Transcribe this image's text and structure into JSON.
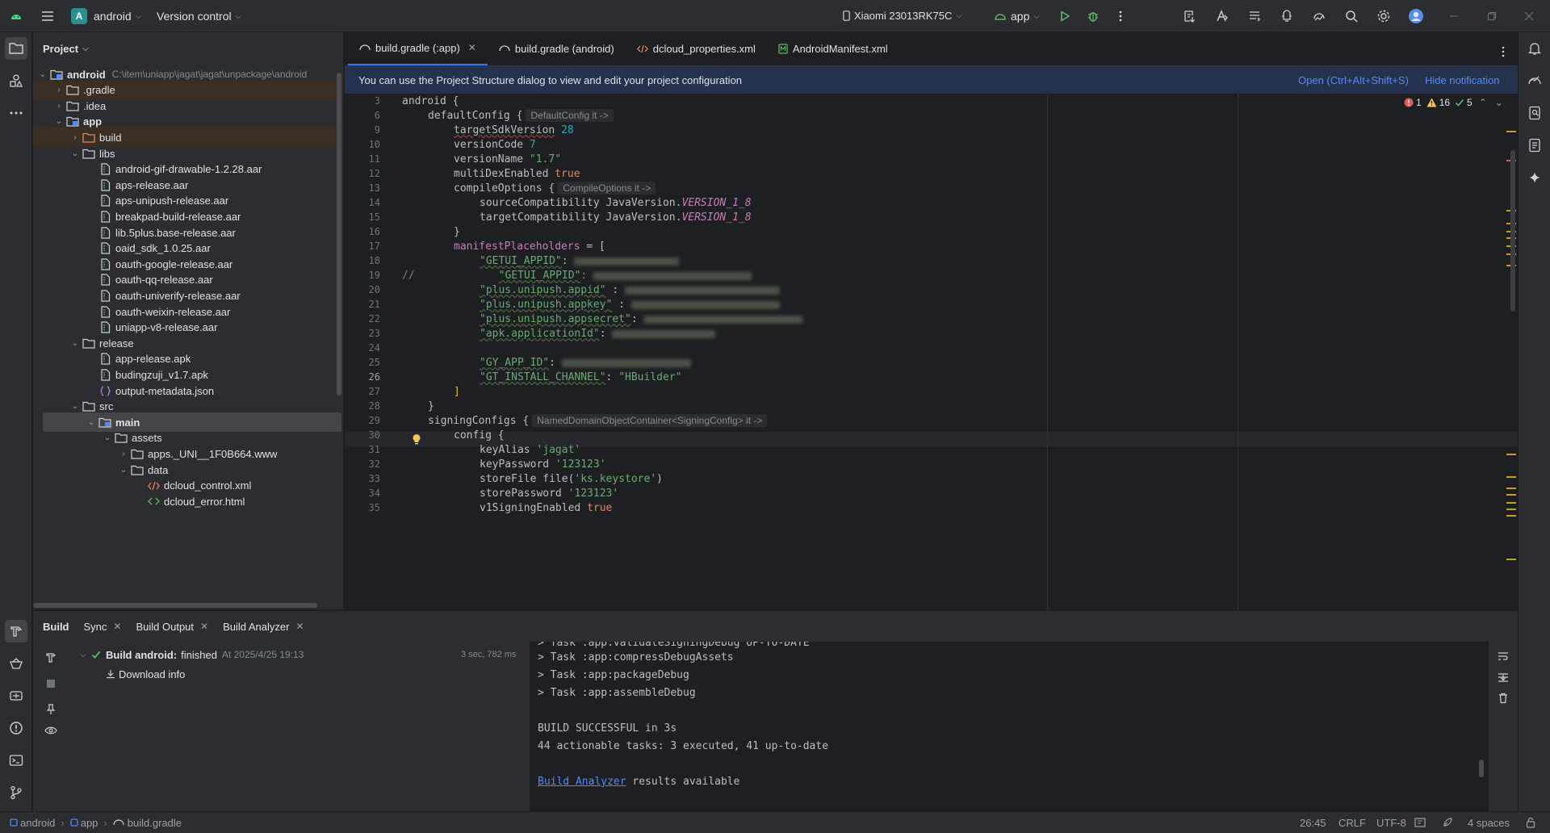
{
  "titlebar": {
    "project_initial": "A",
    "project_name": "android",
    "vcs": "Version control",
    "device": "Xiaomi 23013RK75C",
    "run_config": "app"
  },
  "project_panel": {
    "title": "Project",
    "tree": [
      {
        "label": "android",
        "hint": "C:\\item\\uniapp\\jagat\\jagat\\unpackage\\android",
        "depth": 0,
        "arrow": "open",
        "icon": "module-folder",
        "bold": true
      },
      {
        "label": ".gradle",
        "depth": 1,
        "arrow": "closed",
        "icon": "folder",
        "highlight": true
      },
      {
        "label": ".idea",
        "depth": 1,
        "arrow": "closed",
        "icon": "folder"
      },
      {
        "label": "app",
        "depth": 1,
        "arrow": "open",
        "icon": "module-folder",
        "bold": true
      },
      {
        "label": "build",
        "depth": 2,
        "arrow": "closed",
        "icon": "folder-orange",
        "highlight": true
      },
      {
        "label": "libs",
        "depth": 2,
        "arrow": "open",
        "icon": "folder"
      },
      {
        "label": "android-gif-drawable-1.2.28.aar",
        "depth": 3,
        "icon": "archive"
      },
      {
        "label": "aps-release.aar",
        "depth": 3,
        "icon": "archive"
      },
      {
        "label": "aps-unipush-release.aar",
        "depth": 3,
        "icon": "archive"
      },
      {
        "label": "breakpad-build-release.aar",
        "depth": 3,
        "icon": "archive"
      },
      {
        "label": "lib.5plus.base-release.aar",
        "depth": 3,
        "icon": "archive"
      },
      {
        "label": "oaid_sdk_1.0.25.aar",
        "depth": 3,
        "icon": "archive"
      },
      {
        "label": "oauth-google-release.aar",
        "depth": 3,
        "icon": "archive"
      },
      {
        "label": "oauth-qq-release.aar",
        "depth": 3,
        "icon": "archive"
      },
      {
        "label": "oauth-univerify-release.aar",
        "depth": 3,
        "icon": "archive"
      },
      {
        "label": "oauth-weixin-release.aar",
        "depth": 3,
        "icon": "archive"
      },
      {
        "label": "uniapp-v8-release.aar",
        "depth": 3,
        "icon": "archive"
      },
      {
        "label": "release",
        "depth": 2,
        "arrow": "open",
        "icon": "folder"
      },
      {
        "label": "app-release.apk",
        "depth": 3,
        "icon": "archive"
      },
      {
        "label": "budingzuji_v1.7.apk",
        "depth": 3,
        "icon": "archive"
      },
      {
        "label": "output-metadata.json",
        "depth": 3,
        "icon": "json"
      },
      {
        "label": "src",
        "depth": 2,
        "arrow": "open",
        "icon": "folder"
      },
      {
        "label": "main",
        "depth": 3,
        "arrow": "open",
        "icon": "module-folder",
        "bold": true,
        "selected": true
      },
      {
        "label": "assets",
        "depth": 4,
        "arrow": "open",
        "icon": "folder"
      },
      {
        "label": "apps._UNI__1F0B664.www",
        "depth": 5,
        "arrow": "closed",
        "icon": "folder"
      },
      {
        "label": "data",
        "depth": 5,
        "arrow": "open",
        "icon": "folder"
      },
      {
        "label": "dcloud_control.xml",
        "depth": 6,
        "icon": "xml"
      },
      {
        "label": "dcloud_error.html",
        "depth": 6,
        "icon": "html"
      }
    ]
  },
  "editor": {
    "tabs": [
      {
        "label": "build.gradle (:app)",
        "active": true,
        "closable": true
      },
      {
        "label": "build.gradle (android)"
      },
      {
        "label": "dcloud_properties.xml"
      },
      {
        "label": "AndroidManifest.xml"
      }
    ],
    "notification": {
      "text": "You can use the Project Structure dialog to view and edit your project configuration",
      "open_link": "Open (Ctrl+Alt+Shift+S)",
      "hide_link": "Hide notification"
    },
    "inspections": {
      "errors": "1",
      "warnings": "16",
      "ok": "5"
    },
    "line_numbers": [
      "3",
      "6",
      "9",
      "10",
      "11",
      "12",
      "13",
      "14",
      "15",
      "16",
      "17",
      "18",
      "19",
      "20",
      "21",
      "22",
      "23",
      "24",
      "25",
      "26",
      "27",
      "28",
      "29",
      "30",
      "31",
      "32",
      "33",
      "34",
      "35"
    ],
    "current_line": "26",
    "code": {
      "l3": "android {",
      "l6": "defaultConfig {",
      "l6_hint": "DefaultConfig it ->",
      "l9_key": "targetSdkVersion",
      "l9_val": "28",
      "l10_key": "versionCode",
      "l10_val": "7",
      "l11_key": "versionName",
      "l11_val": "\"1.7\"",
      "l12_key": "multiDexEnabled",
      "l12_val": "true",
      "l13": "compileOptions {",
      "l13_hint": "CompileOptions it ->",
      "l14_key": "sourceCompatibility JavaVersion.",
      "l14_val": "VERSION_1_8",
      "l15_key": "targetCompatibility JavaVersion.",
      "l15_val": "VERSION_1_8",
      "l16": "}",
      "l17_key": "manifestPlaceholders",
      "l17_rest": " = [",
      "l18_key": "\"GETUI_APPID\"",
      "l18_sep": ": ",
      "l19_comment": "//",
      "l19_key": "\"GETUI_APPID\"",
      "l19_sep": ": ",
      "l20_key": "\"plus.unipush.appid\"",
      "l20_sep": " : ",
      "l21_key": "\"plus.unipush.appkey\"",
      "l21_sep": " : ",
      "l22_key": "\"plus.unipush.appsecret\"",
      "l22_sep": ": ",
      "l23_key": "\"apk.applicationId\"",
      "l23_sep": ": ",
      "l25_key": "\"GY_APP_ID\"",
      "l25_sep": ": ",
      "l26_key": "\"GT_INSTALL_CHANNEL\"",
      "l26_sep": ": ",
      "l26_val": "\"HBuilder\"",
      "l27": "]",
      "l28": "}",
      "l29": "signingConfigs {",
      "l29_hint": "NamedDomainObjectContainer<SigningConfig> it ->",
      "l30": "config {",
      "l31_key": "keyAlias",
      "l31_val": "'jagat'",
      "l32_key": "keyPassword",
      "l32_val": "'123123'",
      "l33_key": "storeFile file(",
      "l33_val": "'ks.keystore'",
      "l33_end": ")",
      "l34_key": "storePassword",
      "l34_val": "'123123'",
      "l35_key": "v1SigningEnabled",
      "l35_val": "true"
    }
  },
  "bottom_panel": {
    "tabs": [
      {
        "label": "Build",
        "active": true
      },
      {
        "label": "Sync",
        "closable": true
      },
      {
        "label": "Build Output",
        "closable": true
      },
      {
        "label": "Build Analyzer",
        "closable": true
      }
    ],
    "build_result": {
      "title": "Build android:",
      "status": "finished",
      "time": "At 2025/4/25 19:13",
      "duration": "3 sec, 782 ms",
      "child": "Download info"
    },
    "console": {
      "partial_top": "> Task :app:validateSigningDebug UP-TO-DATE",
      "lines": [
        "> Task :app:compressDebugAssets",
        "> Task :app:packageDebug",
        "> Task :app:assembleDebug",
        "",
        "BUILD SUCCESSFUL in 3s",
        "44 actionable tasks: 3 executed, 41 up-to-date",
        ""
      ],
      "analyzer_link": "Build Analyzer",
      "analyzer_rest": " results available"
    }
  },
  "statusbar": {
    "breadcrumb": [
      "android",
      "app",
      "build.gradle"
    ],
    "position": "26:45",
    "line_sep": "CRLF",
    "encoding": "UTF-8",
    "indent": "4 spaces"
  },
  "colors": {
    "accent": "#3574f0",
    "success": "#5fb865",
    "error": "#db5c5c",
    "warning": "#f2c55c"
  }
}
